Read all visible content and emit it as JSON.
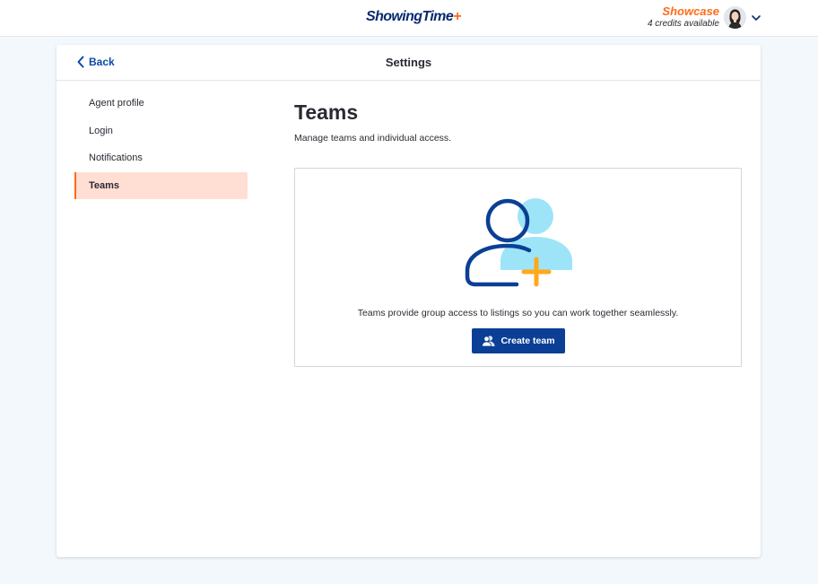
{
  "header": {
    "logo_main": "ShowingTime",
    "logo_plus": "+",
    "brand": "Showcase",
    "credits": "4 credits available"
  },
  "card": {
    "back_label": "Back",
    "title": "Settings"
  },
  "nav": {
    "items": [
      {
        "label": "Agent profile"
      },
      {
        "label": "Login"
      },
      {
        "label": "Notifications"
      },
      {
        "label": "Teams"
      }
    ]
  },
  "main": {
    "title": "Teams",
    "subtitle": "Manage teams and individual access.",
    "empty_text": "Teams provide group access to listings so you can work together seamlessly.",
    "create_label": "Create team"
  },
  "icons": [
    "chevron-left-icon",
    "chevron-down-icon",
    "team-add-illustration",
    "users-icon"
  ],
  "colors": {
    "brand_orange": "#ff6b1a",
    "primary_blue": "#0b3f95",
    "link_blue": "#0b48a8",
    "active_nav_bg": "#ffded3",
    "illustration_light": "#9ee4f8"
  }
}
